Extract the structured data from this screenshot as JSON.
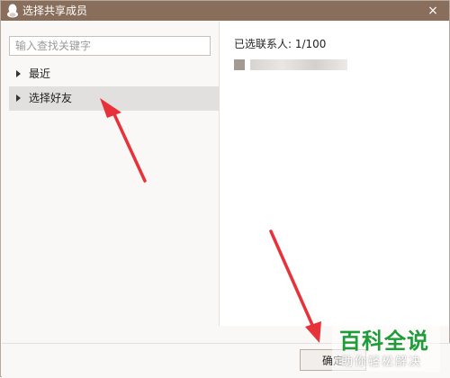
{
  "window": {
    "title": "选择共享成员",
    "close_glyph": "×",
    "title_icon": "qq-penguin-icon"
  },
  "search": {
    "placeholder": "输入查找关键字",
    "value": ""
  },
  "tree": {
    "items": [
      {
        "label": "最近",
        "selected": false
      },
      {
        "label": "选择好友",
        "selected": true
      }
    ]
  },
  "selection": {
    "count_text": "已选联系人: 1/100",
    "members": [
      {
        "name": "(blurred)"
      }
    ]
  },
  "footer": {
    "confirm_label": "确定"
  },
  "watermark": {
    "main": "百科全说",
    "sub": "助你轻松解决"
  },
  "colors": {
    "titlebar": "#8a6e5c",
    "arrow": "#e8323a",
    "selected_row": "#e2e0de",
    "watermark_green": "#1e9c3a"
  }
}
